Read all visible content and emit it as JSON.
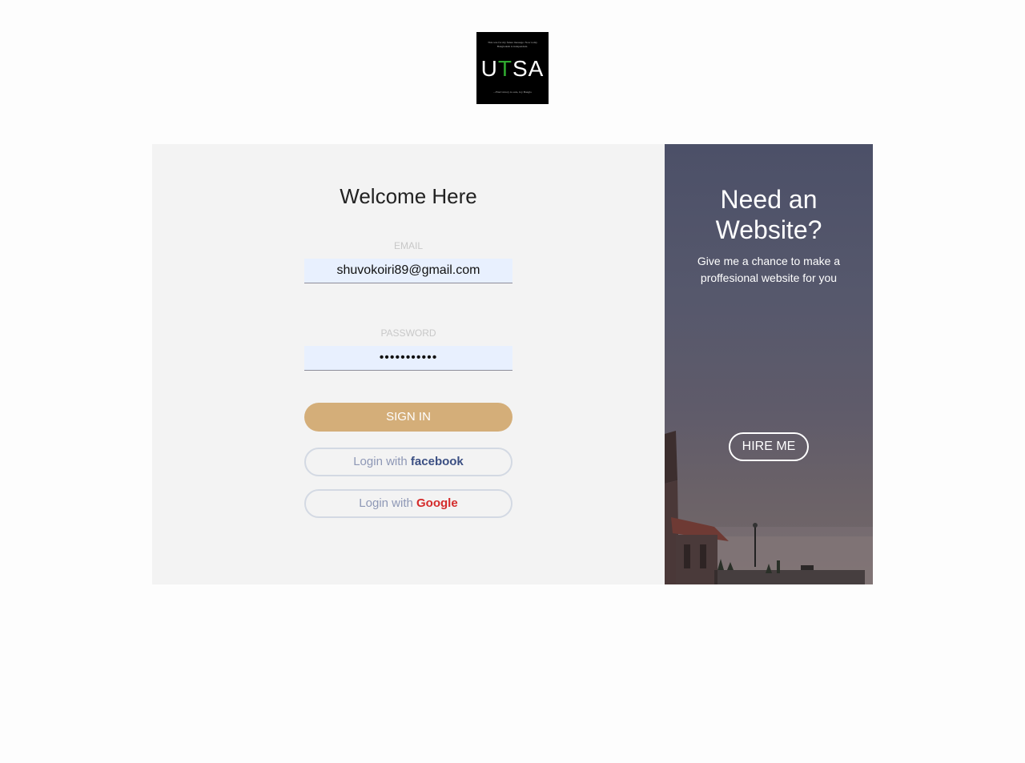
{
  "logo": {
    "mark_u": "U",
    "mark_t": "T",
    "mark_sa": "SA",
    "tagline_top": "This was for my future message. Now today Bangladesh is independent.",
    "tagline_bottom": "...Find victory is ours, Joy Bangla"
  },
  "login": {
    "title": "Welcome Here",
    "email_label": "EMAIL",
    "email_value": "shuvokoiri89@gmail.com",
    "password_label": "PASSWORD",
    "password_value": "•••••••••••",
    "signin_label": "SIGN IN",
    "facebook_prefix": "Login with ",
    "facebook_brand": "facebook",
    "google_prefix": "Login with ",
    "google_brand": "Google"
  },
  "promo": {
    "title_line1": "Need an",
    "title_line2": "Website?",
    "text_line1": "Give me a chance to make a",
    "text_line2": "proffesional website for you",
    "hire_label": "HIRE ME"
  },
  "colors": {
    "signin_button": "#d4ae79",
    "facebook_brand": "#3b4f83",
    "google_brand": "#d42b2b",
    "form_panel_bg": "#f3f3f3",
    "input_bg": "#e8f0fe"
  }
}
